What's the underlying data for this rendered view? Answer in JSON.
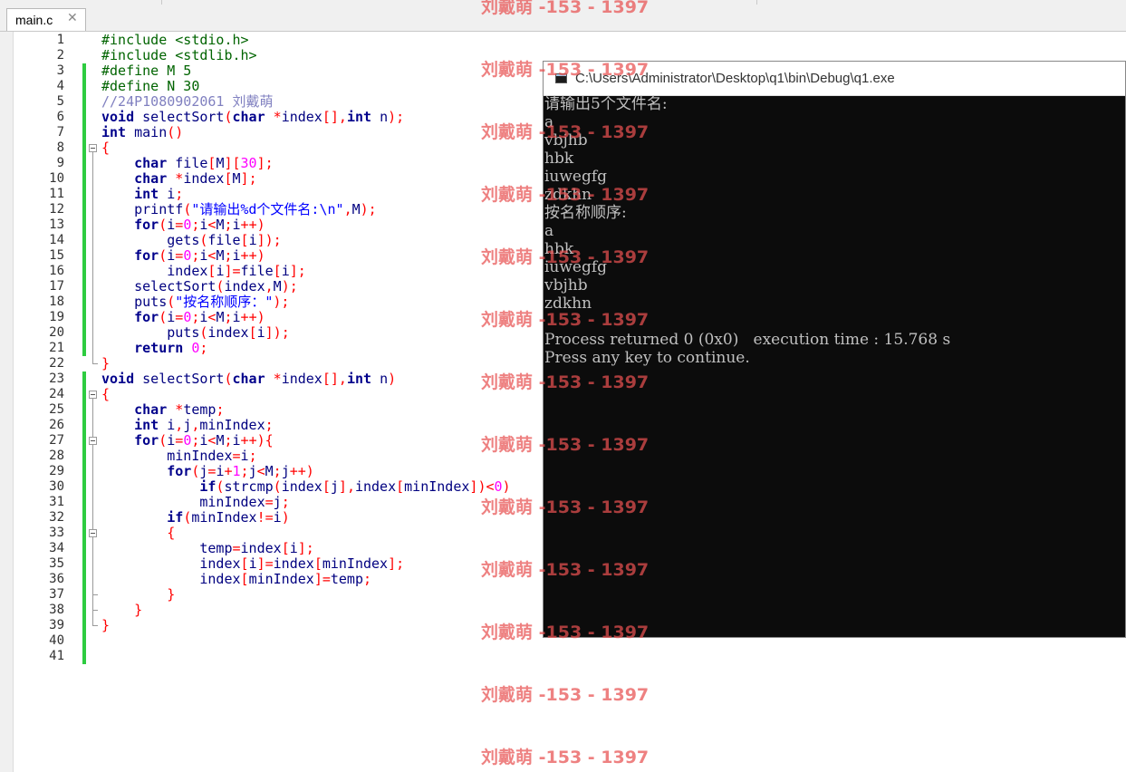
{
  "tab": {
    "label": "main.c",
    "close_icon": "close-icon"
  },
  "editor": {
    "line_numbers": [
      "1",
      "2",
      "3",
      "4",
      "5",
      "6",
      "7",
      "8",
      "9",
      "10",
      "11",
      "12",
      "13",
      "14",
      "15",
      "16",
      "17",
      "18",
      "19",
      "20",
      "21",
      "22",
      "23",
      "24",
      "25",
      "26",
      "27",
      "28",
      "29",
      "30",
      "31",
      "32",
      "33",
      "34",
      "35",
      "36",
      "37",
      "38",
      "39",
      "40",
      "41"
    ],
    "lines": [
      "#include <stdio.h>",
      "#include <stdlib.h>",
      "#define M 5",
      "#define N 30",
      "//24P1080902061 刘戴萌",
      "void selectSort(char *index[],int n);",
      "int main()",
      "{",
      "    char file[M][30];",
      "    char *index[M];",
      "    int i;",
      "    printf(\"请输出%d个文件名:\\n\",M);",
      "    for(i=0;i<M;i++)",
      "        gets(file[i]);",
      "    for(i=0;i<M;i++)",
      "        index[i]=file[i];",
      "    selectSort(index,M);",
      "    puts(\"按名称顺序：\");",
      "    for(i=0;i<M;i++)",
      "        puts(index[i]);",
      "    return 0;",
      "}",
      "void selectSort(char *index[],int n)",
      "{",
      "    char *temp;",
      "    int i,j,minIndex;",
      "    for(i=0;i<M;i++){",
      "        minIndex=i;",
      "        for(j=i+1;j<M;j++)",
      "            if(strcmp(index[j],index[minIndex])<0)",
      "            minIndex=j;",
      "        if(minIndex!=i)",
      "        {",
      "            temp=index[i];",
      "            index[i]=index[minIndex];",
      "            index[minIndex]=temp;",
      "        }",
      "    }",
      "}",
      "",
      ""
    ]
  },
  "console": {
    "title": "C:\\Users\\Administrator\\Desktop\\q1\\bin\\Debug\\q1.exe",
    "lines": [
      "请输出5个文件名:",
      "a",
      "vbjhb",
      "hbk",
      "iuwegfg",
      "zdkhn",
      "按名称顺序:",
      "a",
      "hbk",
      "iuwegfg",
      "vbjhb",
      "zdkhn",
      "",
      "Process returned 0 (0x0)   execution time : 15.768 s",
      "Press any key to continue."
    ]
  },
  "watermark": {
    "text": "刘戴萌 -153 - 1397"
  }
}
